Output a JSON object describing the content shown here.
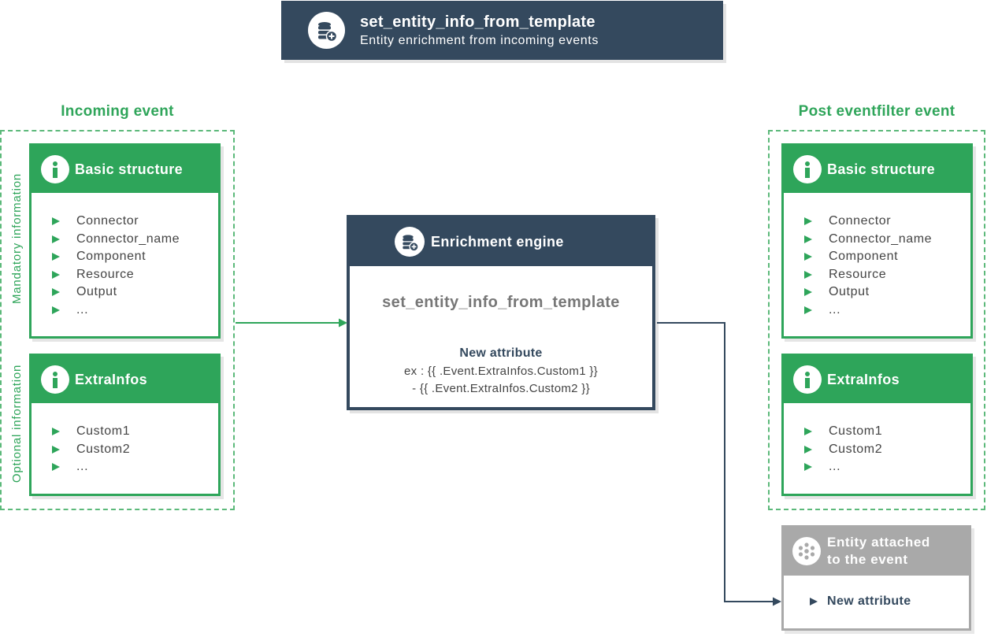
{
  "header": {
    "title": "set_entity_info_from_template",
    "subtitle": "Entity enrichment from incoming events",
    "icon": "database-plus-icon"
  },
  "incoming": {
    "heading": "Incoming event",
    "mandatory_label": "Mandatory information",
    "optional_label": "Optional information",
    "basic": {
      "title": "Basic structure",
      "items": [
        "Connector",
        "Connector_name",
        "Component",
        "Resource",
        "Output",
        "..."
      ]
    },
    "extra": {
      "title": "ExtraInfos",
      "items": [
        "Custom1",
        "Custom2",
        "..."
      ]
    }
  },
  "engine": {
    "title": "Enrichment engine",
    "function": "set_entity_info_from_template",
    "new_attribute_label": "New attribute",
    "example_line1": "ex : {{ .Event.ExtraInfos.Custom1 }}",
    "example_line2": "- {{ .Event.ExtraInfos.Custom2 }}",
    "icon": "database-plus-icon"
  },
  "post": {
    "heading": "Post eventfilter event",
    "basic": {
      "title": "Basic structure",
      "items": [
        "Connector",
        "Connector_name",
        "Component",
        "Resource",
        "Output",
        "..."
      ]
    },
    "extra": {
      "title": "ExtraInfos",
      "items": [
        "Custom1",
        "Custom2",
        "..."
      ]
    }
  },
  "entity": {
    "title_line1": "Entity attached",
    "title_line2": "to the event",
    "item": "New attribute",
    "icon": "entity-network-icon"
  },
  "colors": {
    "green": "#2ea55a",
    "navy": "#34495e",
    "gray": "#a9a9a9"
  }
}
